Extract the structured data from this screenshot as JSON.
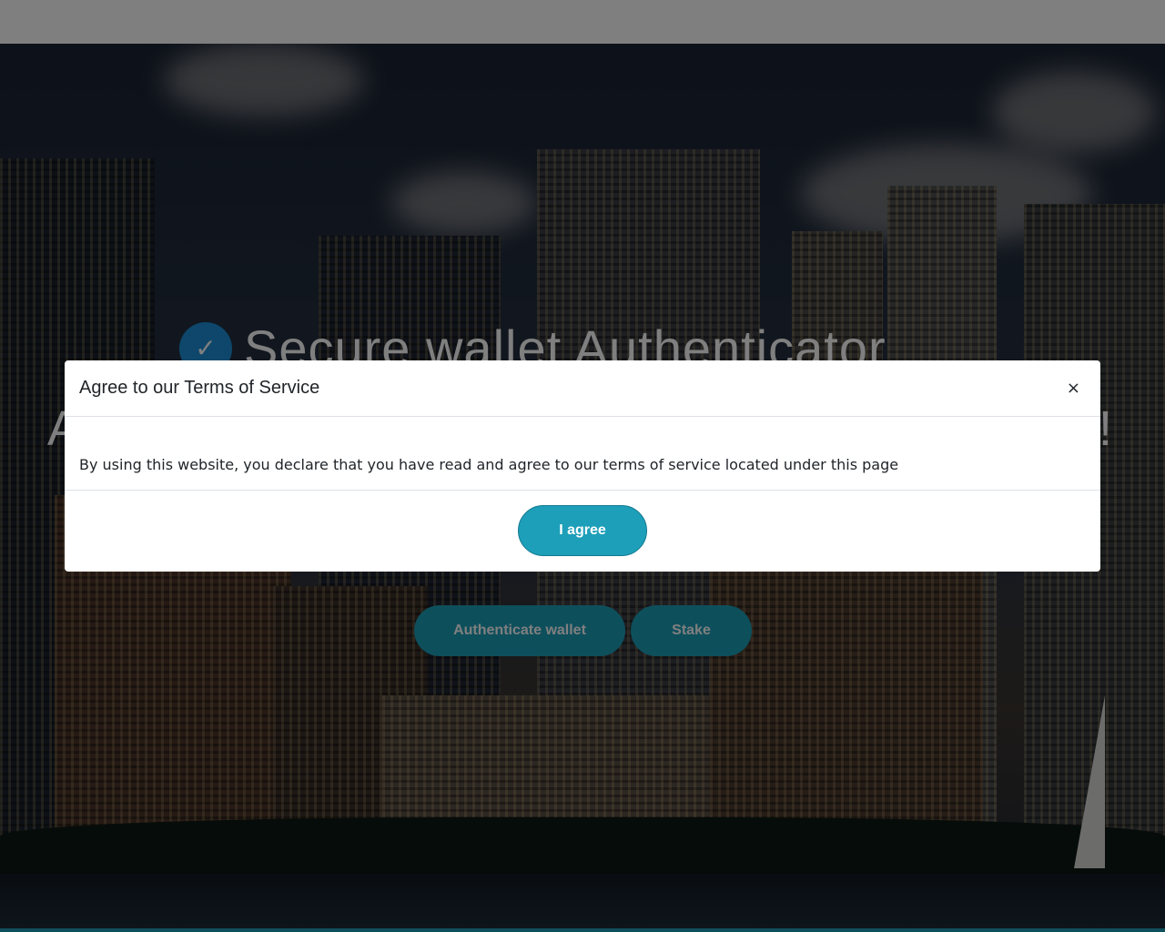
{
  "hero": {
    "title": "Secure wallet Authenticator",
    "subtitle_visible_start": "A",
    "subtitle_visible_end": "!",
    "icon": "verified-badge-icon",
    "buttons": [
      {
        "label": "Authenticate wallet"
      },
      {
        "label": "Stake"
      }
    ]
  },
  "modal": {
    "title": "Agree to our Terms of Service",
    "close_glyph": "×",
    "body": "By using this website, you declare that you have read and agree to our terms of service located under this page",
    "agree_label": "I agree"
  },
  "colors": {
    "accent": "#1d9fb9",
    "badge": "#1c8fd6",
    "overlay": "rgba(0,0,0,0.5)"
  }
}
